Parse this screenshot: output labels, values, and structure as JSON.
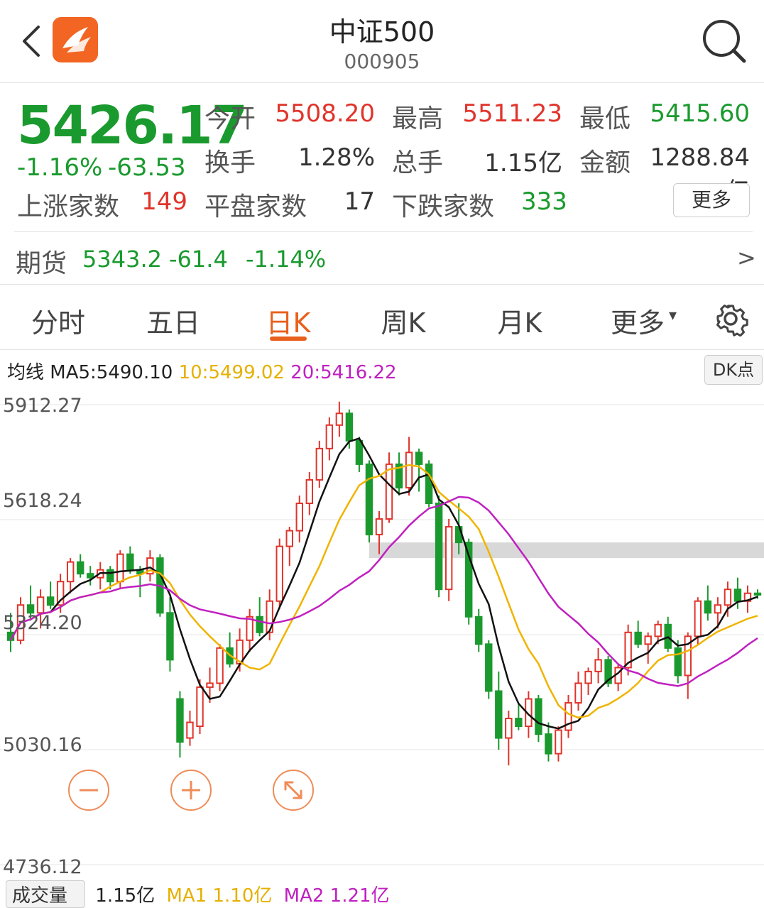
{
  "header": {
    "title": "中证500",
    "code": "000905",
    "back_icon": "chevron-left-icon",
    "app_icon": "app-logo-icon",
    "search_icon": "search-icon"
  },
  "quote": {
    "price": "5426.17",
    "change_pct": "-1.16%",
    "change": "-63.53",
    "open_label": "今开",
    "open": "5508.20",
    "high_label": "最高",
    "high": "5511.23",
    "low_label": "最低",
    "low": "5415.60",
    "turnover_label": "换手",
    "turnover": "1.28%",
    "volume_label": "总手",
    "volume": "1.15亿",
    "amount_label": "金额",
    "amount": "1288.84亿",
    "up_label": "上涨家数",
    "up": "149",
    "flat_label": "平盘家数",
    "flat": "17",
    "down_label": "下跌家数",
    "down": "333",
    "more_label": "更多"
  },
  "futures": {
    "label": "期货",
    "price": "5343.2",
    "change": "-61.4",
    "change_pct": "-1.14%",
    "arrow": ">"
  },
  "tabs": [
    {
      "label": "分时"
    },
    {
      "label": "五日"
    },
    {
      "label": "日K"
    },
    {
      "label": "周K"
    },
    {
      "label": "月K"
    },
    {
      "label": "更多"
    }
  ],
  "active_tab": "日K",
  "more_caret": "▾",
  "settings_icon": "gear-icon",
  "ma": {
    "label": "均线",
    "ma5": "MA5:5490.10",
    "ma10": "10:5499.02",
    "ma20": "20:5416.22",
    "dk_label": "DK点"
  },
  "colors": {
    "up": "#e0342b",
    "down": "#1a9a2e",
    "ma5": "#111111",
    "ma10": "#f0b400",
    "ma20": "#c020c0",
    "accent": "#e8601c"
  },
  "chart_data": {
    "type": "candlestick",
    "y_ticks": [
      "5912.27",
      "5618.24",
      "5324.20",
      "5030.16",
      "4736.12"
    ],
    "ylim": [
      4736.12,
      5912.27
    ],
    "candles": [
      [
        5330,
        5380,
        5280,
        5310
      ],
      [
        5310,
        5420,
        5300,
        5400
      ],
      [
        5400,
        5450,
        5360,
        5380
      ],
      [
        5380,
        5440,
        5340,
        5420
      ],
      [
        5420,
        5460,
        5390,
        5400
      ],
      [
        5400,
        5480,
        5380,
        5460
      ],
      [
        5460,
        5520,
        5430,
        5510
      ],
      [
        5510,
        5530,
        5470,
        5480
      ],
      [
        5480,
        5500,
        5450,
        5470
      ],
      [
        5470,
        5510,
        5440,
        5490
      ],
      [
        5490,
        5500,
        5440,
        5460
      ],
      [
        5460,
        5540,
        5440,
        5530
      ],
      [
        5530,
        5550,
        5480,
        5490
      ],
      [
        5490,
        5500,
        5420,
        5480
      ],
      [
        5480,
        5540,
        5460,
        5520
      ],
      [
        5520,
        5530,
        5370,
        5380
      ],
      [
        5380,
        5420,
        5230,
        5260
      ],
      [
        5160,
        5180,
        5010,
        5050
      ],
      [
        5060,
        5130,
        5040,
        5100
      ],
      [
        5090,
        5210,
        5070,
        5190
      ],
      [
        5190,
        5240,
        5150,
        5200
      ],
      [
        5200,
        5300,
        5180,
        5290
      ],
      [
        5290,
        5330,
        5240,
        5250
      ],
      [
        5250,
        5340,
        5230,
        5310
      ],
      [
        5310,
        5390,
        5280,
        5370
      ],
      [
        5370,
        5420,
        5320,
        5330
      ],
      [
        5330,
        5440,
        5310,
        5410
      ],
      [
        5410,
        5570,
        5390,
        5550
      ],
      [
        5550,
        5600,
        5500,
        5590
      ],
      [
        5590,
        5680,
        5560,
        5660
      ],
      [
        5660,
        5740,
        5630,
        5720
      ],
      [
        5720,
        5820,
        5700,
        5800
      ],
      [
        5800,
        5880,
        5770,
        5860
      ],
      [
        5860,
        5920,
        5830,
        5890
      ],
      [
        5890,
        5900,
        5800,
        5820
      ],
      [
        5820,
        5830,
        5740,
        5760
      ],
      [
        5760,
        5770,
        5560,
        5580
      ],
      [
        5580,
        5640,
        5530,
        5620
      ],
      [
        5620,
        5790,
        5610,
        5760
      ],
      [
        5760,
        5790,
        5680,
        5700
      ],
      [
        5700,
        5830,
        5680,
        5790
      ],
      [
        5790,
        5800,
        5690,
        5760
      ],
      [
        5760,
        5770,
        5650,
        5660
      ],
      [
        5660,
        5680,
        5420,
        5440
      ],
      [
        5440,
        5620,
        5410,
        5600
      ],
      [
        5600,
        5660,
        5530,
        5560
      ],
      [
        5560,
        5570,
        5350,
        5370
      ],
      [
        5370,
        5390,
        5280,
        5300
      ],
      [
        5300,
        5310,
        5160,
        5180
      ],
      [
        5180,
        5230,
        5030,
        5060
      ],
      [
        5060,
        5130,
        4990,
        5110
      ],
      [
        5110,
        5150,
        5080,
        5090
      ],
      [
        5090,
        5180,
        5060,
        5160
      ],
      [
        5160,
        5170,
        5050,
        5070
      ],
      [
        5070,
        5100,
        5000,
        5020
      ],
      [
        5020,
        5090,
        5000,
        5080
      ],
      [
        5080,
        5170,
        5060,
        5150
      ],
      [
        5150,
        5230,
        5130,
        5200
      ],
      [
        5200,
        5240,
        5170,
        5230
      ],
      [
        5230,
        5290,
        5200,
        5260
      ],
      [
        5260,
        5270,
        5190,
        5200
      ],
      [
        5200,
        5250,
        5180,
        5240
      ],
      [
        5240,
        5350,
        5220,
        5330
      ],
      [
        5330,
        5360,
        5290,
        5300
      ],
      [
        5300,
        5330,
        5250,
        5320
      ],
      [
        5320,
        5360,
        5300,
        5350
      ],
      [
        5350,
        5370,
        5280,
        5290
      ],
      [
        5290,
        5310,
        5200,
        5220
      ],
      [
        5220,
        5330,
        5160,
        5320
      ],
      [
        5320,
        5420,
        5300,
        5410
      ],
      [
        5410,
        5450,
        5360,
        5380
      ],
      [
        5380,
        5420,
        5340,
        5400
      ],
      [
        5400,
        5460,
        5370,
        5440
      ],
      [
        5440,
        5470,
        5390,
        5410
      ],
      [
        5410,
        5450,
        5380,
        5430
      ],
      [
        5430,
        5440,
        5416,
        5426
      ]
    ]
  },
  "chart_controls": {
    "zoom_out_icon": "zoom-out-icon",
    "zoom_in_icon": "zoom-in-icon",
    "fullscreen_icon": "expand-icon"
  },
  "volume": {
    "label": "成交量",
    "value": "1.15亿",
    "ma1": "MA1 1.10亿",
    "ma2": "MA2 1.21亿"
  }
}
